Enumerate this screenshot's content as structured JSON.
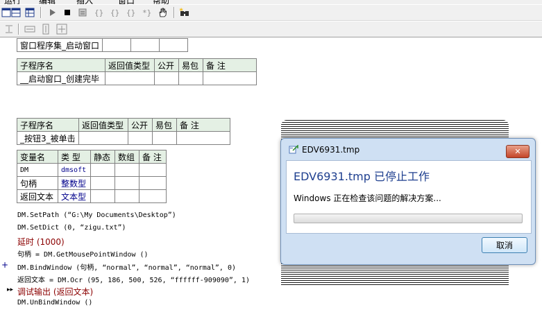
{
  "menubar": {
    "items": [
      "运行",
      "编辑",
      "插入",
      "窗口",
      "帮助"
    ]
  },
  "toolbar_row1": {
    "icons": [
      "layout-icon",
      "window-icon",
      "table-icon",
      "run-icon",
      "stop-icon",
      "step-icon",
      "step-into-icon",
      "step-over-icon",
      "step-out-icon",
      "run-to-cursor-icon",
      "hand-icon",
      "find-icon"
    ]
  },
  "toolbar_row2": {
    "icons": [
      "align-icon",
      "width-icon",
      "height-icon",
      "size-icon"
    ]
  },
  "assembly_table": {
    "name": "窗口程序集_启动窗口",
    "cells": [
      "",
      "",
      ""
    ]
  },
  "sub1_table": {
    "headers": [
      "子程序名",
      "返回值类型",
      "公开",
      "易包",
      "备 注"
    ],
    "row": [
      "__启动窗口_创建完毕",
      "",
      "",
      "",
      ""
    ]
  },
  "sub2_table": {
    "headers": [
      "子程序名",
      "返回值类型",
      "公开",
      "易包",
      "备 注"
    ],
    "row": [
      "_按钮3_被单击",
      "",
      "",
      "",
      ""
    ]
  },
  "var_table": {
    "headers": [
      "变量名",
      "类 型",
      "静态",
      "数组",
      "备 注"
    ],
    "rows": [
      {
        "name": "DM",
        "type": "dmsoft"
      },
      {
        "name": "句柄",
        "type": "整数型"
      },
      {
        "name": "返回文本",
        "type": "文本型"
      }
    ]
  },
  "code": {
    "line1": "DM.SetPath (“G:\\My Documents\\Desktop”)",
    "line2": "DM.SetDict (0, “zigu.txt”)",
    "line3": "延时 (1000)",
    "line4": "句柄 = DM.GetMousePointWindow ()",
    "line5": "DM.BindWindow (句柄, “normal”, “normal”, “normal”, 0)",
    "line6": "返回文本 = DM.Ocr (95, 186, 500, 526, “ffffff-909090”, 1)",
    "line7": "调试输出 (返回文本)",
    "line8": "DM.UnBindWindow ()"
  },
  "gutter": {
    "plus": "+",
    "arrow": "▸▸"
  },
  "dialog": {
    "title": "EDV6931.tmp",
    "close_label": "✕",
    "heading": "EDV6931.tmp 已停止工作",
    "message": "Windows 正在检查该问题的解决方案...",
    "progress": 0.0,
    "cancel_label": "取消"
  }
}
